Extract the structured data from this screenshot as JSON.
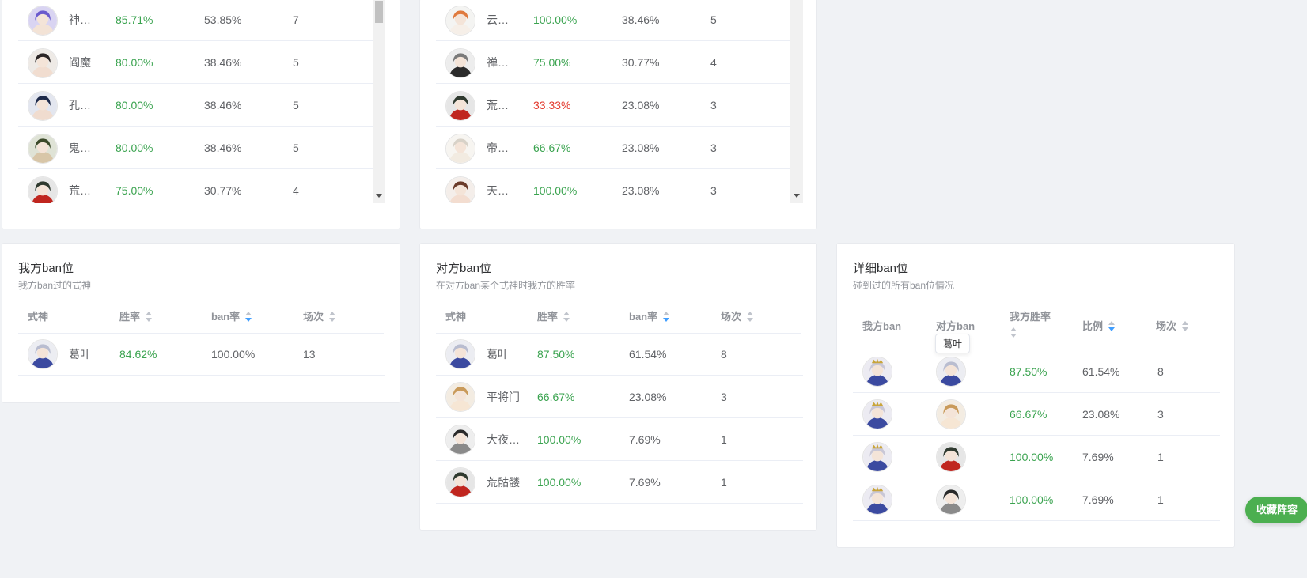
{
  "top_left_table": {
    "rows": [
      {
        "name": "神…",
        "win": "85.71%",
        "rate": "53.85%",
        "count": "7",
        "win_color": "green",
        "avatar": "purple-hair"
      },
      {
        "name": "阎魔",
        "win": "80.00%",
        "rate": "38.46%",
        "count": "5",
        "win_color": "green",
        "avatar": "dark-hat"
      },
      {
        "name": "孔…",
        "win": "80.00%",
        "rate": "38.46%",
        "count": "5",
        "win_color": "green",
        "avatar": "dark-blue"
      },
      {
        "name": "鬼…",
        "win": "80.00%",
        "rate": "38.46%",
        "count": "5",
        "win_color": "green",
        "avatar": "green-dark"
      },
      {
        "name": "荒…",
        "win": "75.00%",
        "rate": "30.77%",
        "count": "4",
        "win_color": "green",
        "avatar": "dark-red"
      }
    ]
  },
  "top_right_table": {
    "rows": [
      {
        "name": "云…",
        "win": "100.00%",
        "rate": "38.46%",
        "count": "5",
        "win_color": "green",
        "avatar": "white-orange"
      },
      {
        "name": "禅…",
        "win": "75.00%",
        "rate": "30.77%",
        "count": "4",
        "win_color": "green",
        "avatar": "silver"
      },
      {
        "name": "荒…",
        "win": "33.33%",
        "rate": "23.08%",
        "count": "3",
        "win_color": "red",
        "avatar": "dark-red"
      },
      {
        "name": "帝…",
        "win": "66.67%",
        "rate": "23.08%",
        "count": "3",
        "win_color": "green",
        "avatar": "white"
      },
      {
        "name": "天…",
        "win": "100.00%",
        "rate": "23.08%",
        "count": "3",
        "win_color": "green",
        "avatar": "brown"
      }
    ]
  },
  "my_ban": {
    "title": "我方ban位",
    "subtitle": "我方ban过的式神",
    "headers": {
      "shikigami": "式神",
      "win": "胜率",
      "ban_rate": "ban率",
      "count": "场次"
    },
    "rows": [
      {
        "name": "葛叶",
        "win": "84.62%",
        "rate": "100.00%",
        "count": "13",
        "avatar": "silver-blue"
      }
    ]
  },
  "enemy_ban": {
    "title": "对方ban位",
    "subtitle": "在对方ban某个式神时我方的胜率",
    "headers": {
      "shikigami": "式神",
      "win": "胜率",
      "ban_rate": "ban率",
      "count": "场次"
    },
    "rows": [
      {
        "name": "葛叶",
        "win": "87.50%",
        "rate": "61.54%",
        "count": "8",
        "avatar": "silver-blue"
      },
      {
        "name": "平将门",
        "win": "66.67%",
        "rate": "23.08%",
        "count": "3",
        "avatar": "gold"
      },
      {
        "name": "大夜…",
        "win": "100.00%",
        "rate": "7.69%",
        "count": "1",
        "avatar": "dark-spiky"
      },
      {
        "name": "荒骷髅",
        "win": "100.00%",
        "rate": "7.69%",
        "count": "1",
        "avatar": "dark-red"
      }
    ]
  },
  "detail_ban": {
    "title": "详细ban位",
    "subtitle": "碰到过的所有ban位情况",
    "headers": {
      "my_ban": "我方ban",
      "enemy_ban": "对方ban",
      "my_win": "我方胜率",
      "ratio": "比例",
      "count": "场次"
    },
    "tooltip": "葛叶",
    "rows": [
      {
        "mine": "crowned",
        "theirs": "silver-blue",
        "win": "87.50%",
        "ratio": "61.54%",
        "count": "8"
      },
      {
        "mine": "crowned",
        "theirs": "gold",
        "win": "66.67%",
        "ratio": "23.08%",
        "count": "3"
      },
      {
        "mine": "crowned",
        "theirs": "dark-red",
        "win": "100.00%",
        "ratio": "7.69%",
        "count": "1"
      },
      {
        "mine": "crowned",
        "theirs": "dark-spiky",
        "win": "100.00%",
        "ratio": "7.69%",
        "count": "1"
      }
    ]
  },
  "favorite_button": {
    "label": "收藏阵容"
  },
  "colors": {
    "win_green": "#3aa34f",
    "loss_red": "#e2372b",
    "accent_blue": "#409eff",
    "fav_green": "#4caf50"
  }
}
